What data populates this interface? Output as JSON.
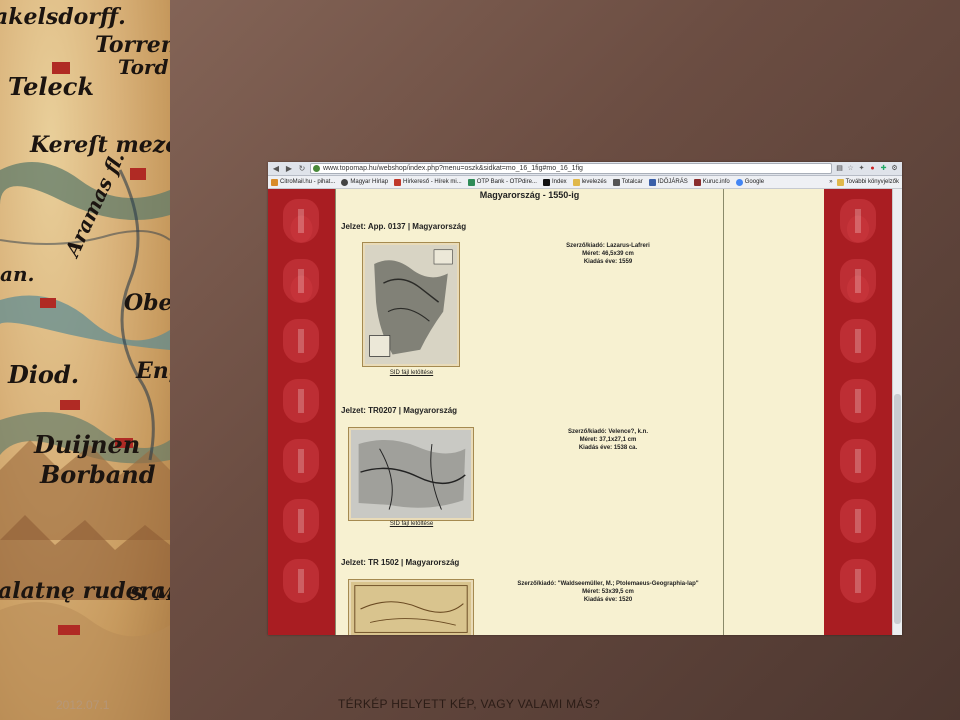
{
  "slide": {
    "date": "2012.07.1",
    "caption": "TÉRKÉP HELYETT KÉP, VAGY VALAMI MÁS?"
  },
  "map_panel": {
    "words": [
      "akelsdorff.",
      "Torren",
      "Tord",
      "Teleck",
      "Kereſt mezo",
      "Aramas fl.",
      "an.",
      "Ober",
      "Diod.",
      "Eng",
      "Duijnen",
      "Borband",
      "alatnę rudera.",
      "S. M"
    ]
  },
  "browser": {
    "url": "www.topomap.hu/webshop/index.php?menu=oszk&sidkat=mo_16_1fig#mo_16_1fig",
    "bookmarks": [
      {
        "label": "CitroMail.hu - pihat...",
        "color": "#d98c2a"
      },
      {
        "label": "Magyar Hírlap",
        "color": "#444444"
      },
      {
        "label": "Hírkereső - Hírek mi...",
        "color": "#c0392b"
      },
      {
        "label": "OTP Bank - OTPdire...",
        "color": "#2e8b57"
      },
      {
        "label": "Index",
        "color": "#111111"
      },
      {
        "label": "levelezés",
        "color": "#e0b84a"
      },
      {
        "label": "Totalcar",
        "color": "#555555"
      },
      {
        "label": "IDŐJÁRÁS",
        "color": "#3a5fa8"
      },
      {
        "label": "Kuruc.info",
        "color": "#8a2d2d"
      },
      {
        "label": "Google",
        "color": "#4285f4"
      }
    ],
    "bookmarks_more": "»",
    "other_bookmarks": "További könyvjelzők"
  },
  "page": {
    "title": "Magyarország - 1550-ig",
    "entries": [
      {
        "heading": "Jelzet: App. 0137 | Magyarország",
        "author": "Szerző/kiadó: Lazarus-Lafreri",
        "size": "Méret: 46,5x39 cm",
        "year": "Kiadás éve: 1559",
        "link": "SID fájl letöltése"
      },
      {
        "heading": "Jelzet: TR0207 | Magyarország",
        "author": "Szerző/kiadó: Velence?, k.n.",
        "size": "Méret: 37,1x27,1 cm",
        "year": "Kiadás éve: 1538 ca.",
        "link": "SID fájl letöltése"
      },
      {
        "heading": "Jelzet: TR 1502 | Magyarország",
        "author": "Szerző/kiadó: \"Waldseemüller, M.; Ptolemaeus-Geographia-lap\"",
        "size": "Méret: 53x39,5 cm",
        "year": "Kiadás éve: 1520",
        "link": ""
      }
    ]
  }
}
